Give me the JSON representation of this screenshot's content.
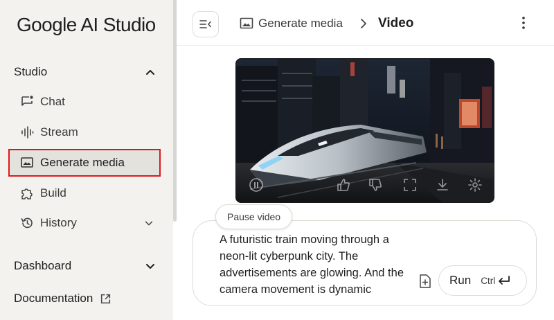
{
  "sidebar": {
    "logo": "Google AI Studio",
    "studio_section": {
      "label": "Studio",
      "expanded": true
    },
    "items": [
      {
        "label": "Chat",
        "icon": "chat-icon"
      },
      {
        "label": "Stream",
        "icon": "waveform-icon"
      },
      {
        "label": "Generate media",
        "icon": "image-icon",
        "active": true
      },
      {
        "label": "Build",
        "icon": "puzzle-icon"
      },
      {
        "label": "History",
        "icon": "history-icon"
      }
    ],
    "dashboard": {
      "label": "Dashboard"
    },
    "documentation": {
      "label": "Documentation"
    }
  },
  "header": {
    "breadcrumb_parent": "Generate media",
    "breadcrumb_current": "Video"
  },
  "video": {
    "tooltip": "Pause video"
  },
  "prompt": {
    "text": "A futuristic train moving through a neon-lit cyberpunk city. The advertisements are glowing. And the camera movement is dynamic",
    "run_label": "Run",
    "shortcut_label": "Ctrl"
  },
  "colors": {
    "sidebar_bg": "#f3f2ee",
    "active_item_bg": "#e3e2dd",
    "highlight_outline": "#e0161b"
  }
}
